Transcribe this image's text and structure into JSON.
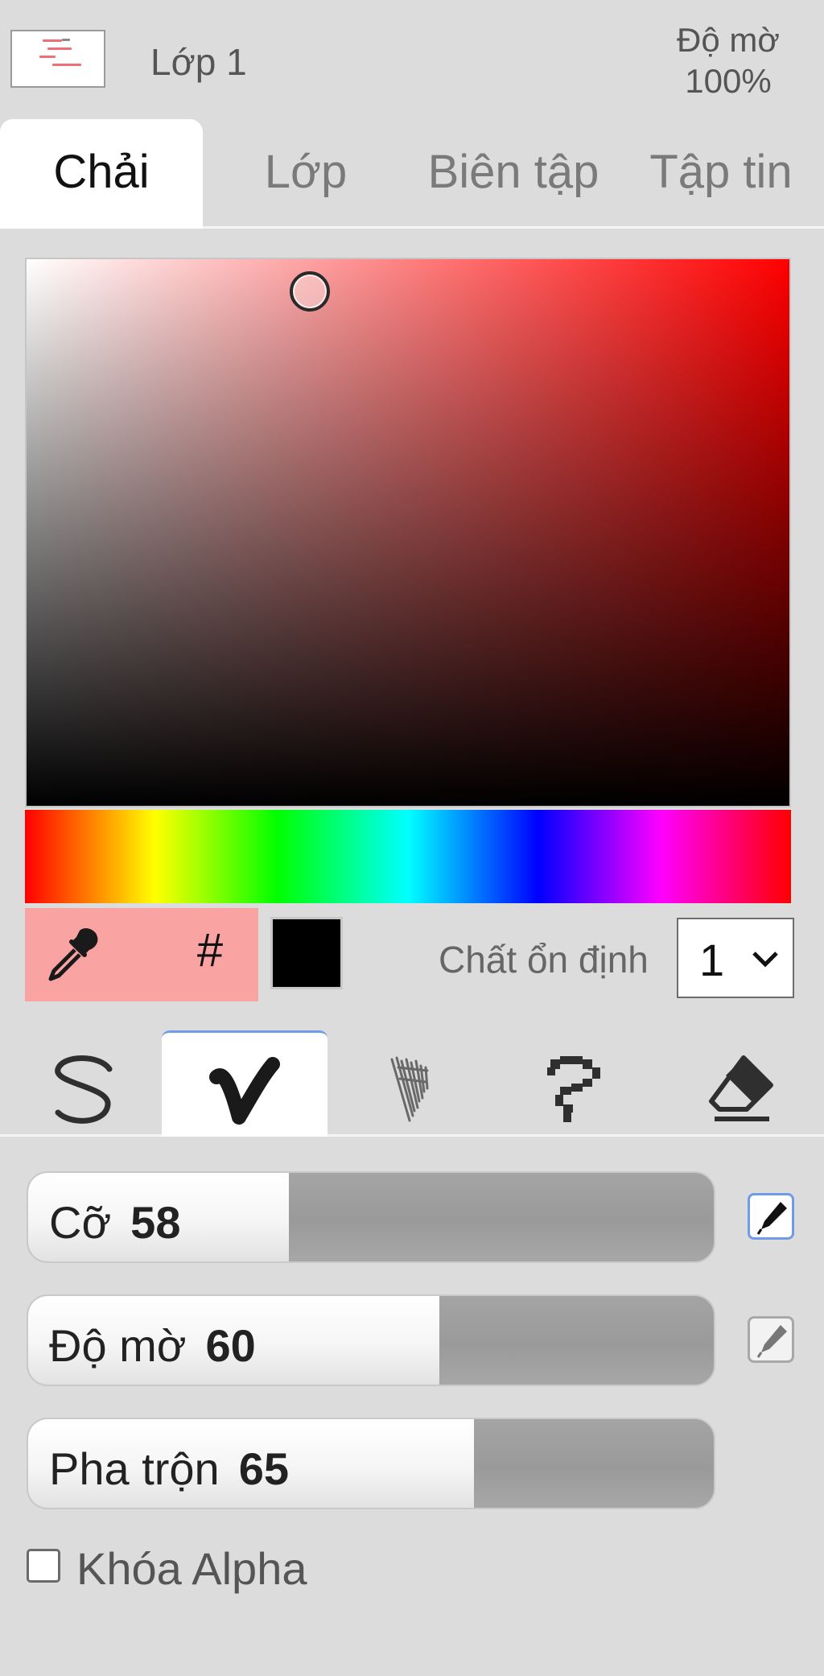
{
  "layer": {
    "name": "Lớp 1",
    "opacity_label": "Độ mờ",
    "opacity_value": "100%"
  },
  "main_tabs": [
    {
      "label": "Chải",
      "active": true
    },
    {
      "label": "Lớp",
      "active": false
    },
    {
      "label": "Biên tập",
      "active": false
    },
    {
      "label": "Tập tin",
      "active": false
    }
  ],
  "color_picker": {
    "hue_color": "#ff0000",
    "current_color": "#f9a3a2",
    "secondary_color": "#000000",
    "hex_button_label": "#",
    "eyedropper_icon": "eyedropper-icon"
  },
  "stabilizer": {
    "label": "Chất ổn định",
    "value": "1"
  },
  "brush_tools": [
    {
      "icon": "pen-stroke-icon",
      "active": false
    },
    {
      "icon": "blend-brush-icon",
      "active": true
    },
    {
      "icon": "sketchy-brush-icon",
      "active": false
    },
    {
      "icon": "pixel-pen-icon",
      "active": false
    },
    {
      "icon": "eraser-icon",
      "active": false
    }
  ],
  "sliders": {
    "size": {
      "label": "Cỡ",
      "value": "58",
      "fill_fraction": 0.38
    },
    "opacity": {
      "label": "Độ mờ",
      "value": "60",
      "fill_fraction": 0.6
    },
    "blend": {
      "label": "Pha trộn",
      "value": "65",
      "fill_fraction": 0.65
    }
  },
  "pressure": {
    "size_enabled": true,
    "opacity_enabled": false
  },
  "alpha_lock": {
    "label": "Khóa Alpha",
    "checked": false
  }
}
